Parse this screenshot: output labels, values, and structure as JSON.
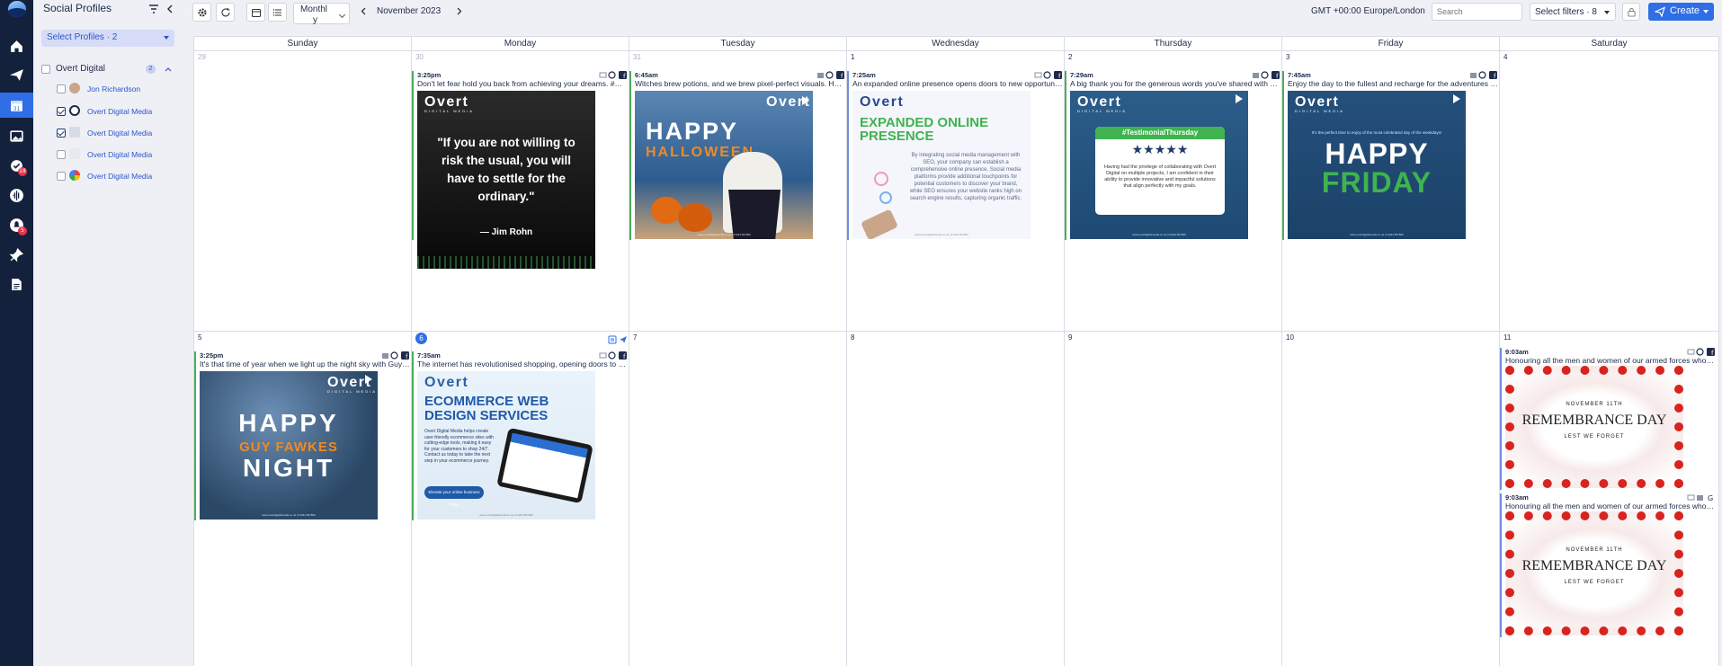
{
  "icons": {
    "rail": [
      "home-icon",
      "send-icon",
      "calendar-icon",
      "image-icon",
      "inbox-icon",
      "audio-wave-icon",
      "notification-icon",
      "pin-icon",
      "report-icon"
    ],
    "toolbar": [
      "settings-icon",
      "refresh-icon",
      "calendar-view-icon",
      "list-view-icon"
    ],
    "post_channels": [
      "photo-icon",
      "instagram-icon",
      "facebook-icon",
      "google-business-icon",
      "building-icon"
    ]
  },
  "rail_badges": {
    "inbox": "18",
    "notifications": "5"
  },
  "panel": {
    "title": "Social Profiles",
    "select_profiles": "Select Profiles · 2",
    "group": {
      "name": "Overt Digital",
      "count": "2"
    },
    "profiles": [
      {
        "name": "Jon Richardson",
        "checked": false,
        "warning": false
      },
      {
        "name": "Overt Digital Media",
        "checked": true,
        "warning": false
      },
      {
        "name": "Overt Digital Media",
        "checked": true,
        "warning": false
      },
      {
        "name": "Overt Digital Media",
        "checked": false,
        "warning": false
      },
      {
        "name": "Overt Digital Media",
        "checked": false,
        "warning": true
      }
    ]
  },
  "toolbar": {
    "view_line1": "Monthl",
    "view_line2": "y",
    "month": "November 2023",
    "timezone": "GMT +00:00 Europe/London",
    "search_placeholder": "Search",
    "filters": "Select filters · 8",
    "create": "Create"
  },
  "calendar": {
    "weekdays": [
      "Sunday",
      "Monday",
      "Tuesday",
      "Wednesday",
      "Thursday",
      "Friday",
      "Saturday"
    ],
    "week1": [
      "29",
      "30",
      "31",
      "1",
      "2",
      "3",
      "4"
    ],
    "week2": [
      "5",
      "6",
      "7",
      "8",
      "9",
      "10",
      "11"
    ],
    "posts": {
      "mon30": {
        "time": "3:25pm",
        "text": "Don't let fear hold you back from achieving your dreams. #MotivationMonday"
      },
      "tue31": {
        "time": "6:45am",
        "text": "Witches brew potions, and we brew pixel-perfect visuals. Happy Halloween!"
      },
      "wed1": {
        "time": "7:25am",
        "text": "An expanded online presence opens doors to new opportunities for your business."
      },
      "thu2": {
        "time": "7:29am",
        "text": "A big thank you for the generous words you've shared with us! #TestimonialThursday"
      },
      "fri3": {
        "time": "7:45am",
        "text": "Enjoy the day to the fullest and recharge for the adventures ahead. Happy Friday!"
      },
      "sun5": {
        "time": "3:25pm",
        "text": "It's that time of year when we light up the night sky with Guy Fawkes Night!"
      },
      "mon6": {
        "time": "7:35am",
        "text": "The internet has revolutionised shopping, opening doors to new customers."
      },
      "sat11a": {
        "time": "9:03am",
        "text": "Honouring all the men and women of our armed forces who served."
      },
      "sat11b": {
        "time": "9:03am",
        "text": "Honouring all the men and women of our armed forces who served."
      }
    }
  },
  "thumbs": {
    "brand": "Overt",
    "brand_sub": "DIGITAL MEDIA",
    "footer": "www.overtdigitalmedia.co.uk | 01234 567890",
    "quote": "\"If you are not willing to risk the usual, you will have to settle for the ordinary.\"",
    "quote_author": "— Jim Rohn",
    "halloween_1": "HAPPY",
    "halloween_2": "HALLOWEEN",
    "expanded_title": "EXPANDED ONLINE PRESENCE",
    "expanded_body": "By integrating social media management with SEO, your company can establish a comprehensive online presence. Social media platforms provide additional touchpoints for potential customers to discover your brand, while SEO ensures your website ranks high on search engine results, capturing organic traffic.",
    "testimonial_tag": "#TestimonialThursday",
    "testimonial_stars": "★★★★★",
    "testimonial_body": "Having had the privilege of collaborating with Overt Digital on multiple projects, I am confident in their ability to provide innovative and impactful solutions that align perfectly with my goals.",
    "friday_top": "It's the perfect time to enjoy of the most celebrated day of the weekdays!",
    "friday_1": "HAPPY",
    "friday_2": "FRIDAY",
    "fawkes_1": "HAPPY",
    "fawkes_2": "GUY FAWKES",
    "fawkes_3": "NIGHT",
    "ecom_title": "ECOMMERCE WEB DESIGN SERVICES",
    "ecom_body": "Overt Digital Media helps create user-friendly ecommerce sites with cutting-edge tools, making it easy for your customers to shop 24/7. Contact us today to take the next step in your ecommerce journey.",
    "ecom_cta": "Elevate your online business today",
    "remembrance_date": "NOVEMBER 11TH",
    "remembrance_title": "REMEMBRANCE DAY",
    "remembrance_sub": "LEST WE FORGET"
  }
}
